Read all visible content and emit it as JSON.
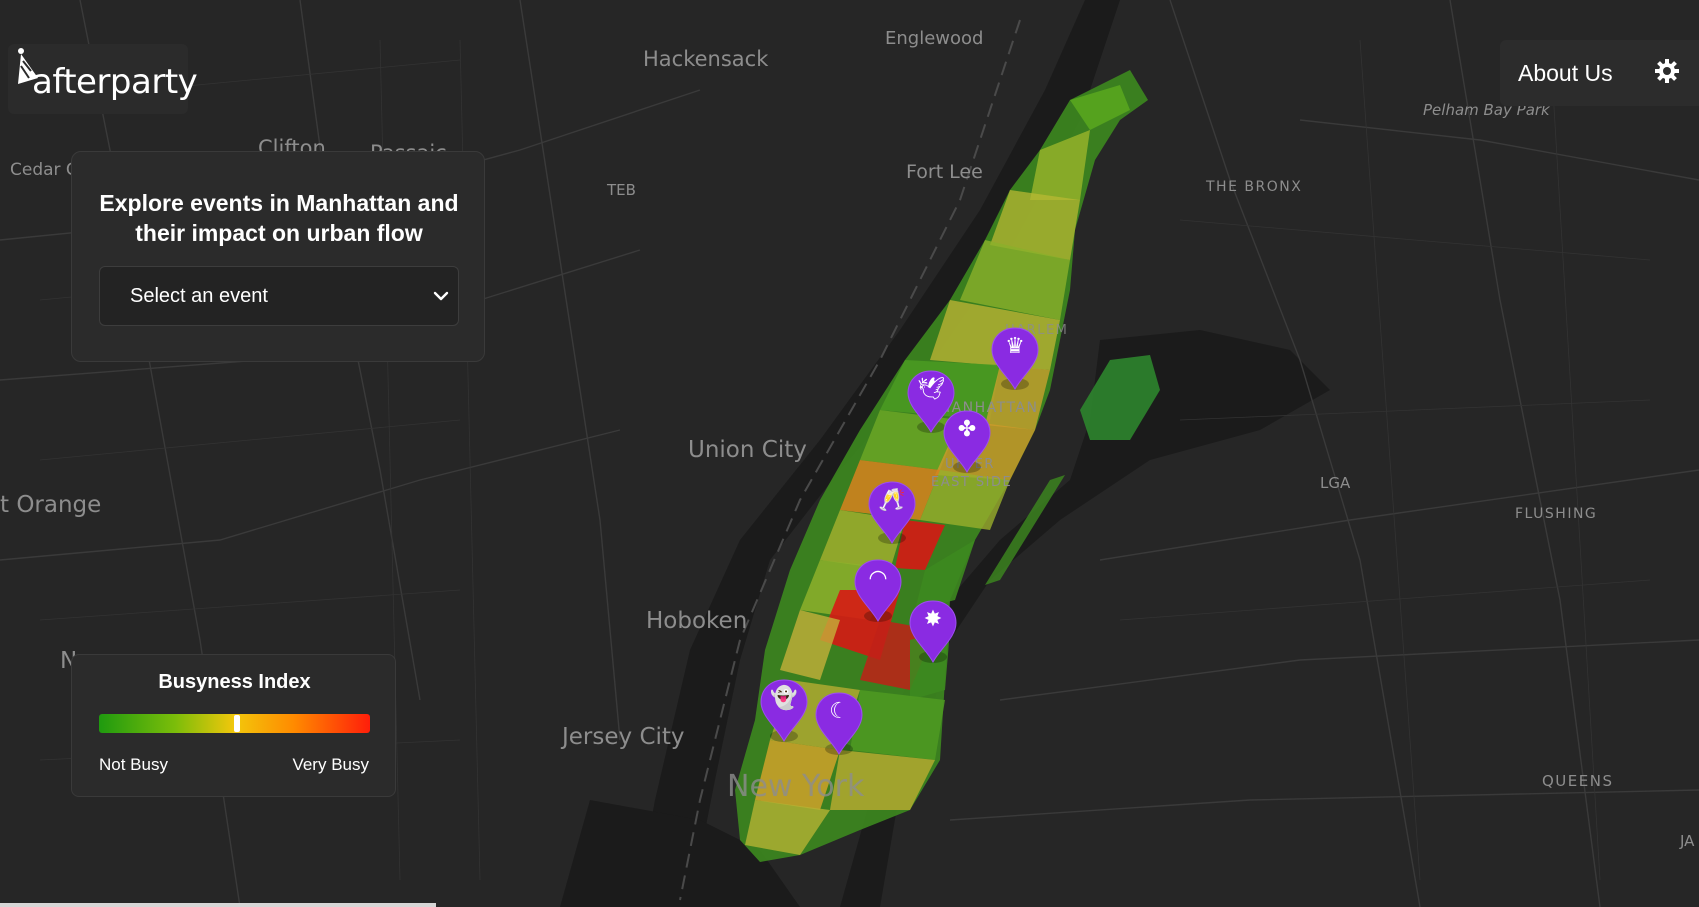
{
  "app": {
    "name": "afterparty"
  },
  "header": {
    "about_label": "About Us",
    "settings_icon": "gear-icon"
  },
  "explore": {
    "title": "Explore events in Manhattan and their impact on urban flow",
    "select_placeholder": "Select an event"
  },
  "legend": {
    "title": "Busyness Index",
    "low_label": "Not Busy",
    "high_label": "Very Busy",
    "marker_position": 0.51,
    "gradient_colors": [
      "#1f9a0f",
      "#7bbd0a",
      "#f2c70c",
      "#ff8a00",
      "#ff1e0a"
    ]
  },
  "map": {
    "labels": {
      "hackensack": "Hackensack",
      "englewood": "Englewood",
      "pelham_bay_park": "Pelham Bay Park",
      "clifton": "Clifton",
      "passaic": "Passaic",
      "cedar": "Cedar G",
      "teb": "TEB",
      "fort_lee": "Fort Lee",
      "the_bronx": "THE BRONX",
      "harlem": "HARLEM",
      "manhattan": "MANHATTAN",
      "upper": "UPPER",
      "east_side": "EAST SIDE",
      "union_city": "Union City",
      "lga": "LGA",
      "flushing": "FLUSHING",
      "east_orange": "t Orange",
      "hoboken": "Hoboken",
      "newark": "N",
      "jersey_city": "Jersey City",
      "new_york": "New York",
      "queens": "QUEENS",
      "ja": "JA"
    },
    "colors": {
      "background": "#262626",
      "marker": "#8a2be2",
      "busy_red": "#d61a14",
      "quiet_green": "#2e8b2e"
    }
  },
  "events": [
    {
      "icon": "crown-icon",
      "glyph": "♛"
    },
    {
      "icon": "dove-icon",
      "glyph": "🕊"
    },
    {
      "icon": "clover-icon",
      "glyph": "✤"
    },
    {
      "icon": "cheers-icon",
      "glyph": "🥂"
    },
    {
      "icon": "rainbow-icon",
      "glyph": "◠"
    },
    {
      "icon": "sparkle-icon",
      "glyph": "✸"
    },
    {
      "icon": "ghost-icon",
      "glyph": "👻"
    },
    {
      "icon": "moon-icon",
      "glyph": "☾"
    }
  ]
}
